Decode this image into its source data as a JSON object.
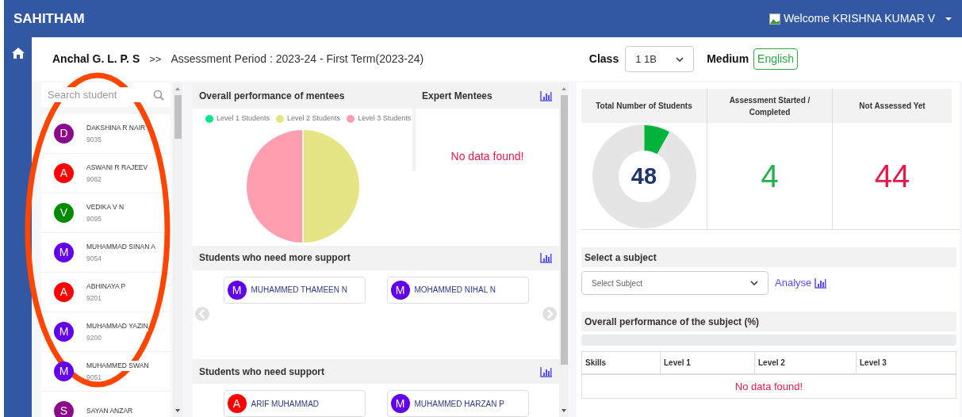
{
  "header": {
    "brand": "SAHITHAM",
    "welcome": "Welcome KRISHNA KUMAR V"
  },
  "breadcrumb": {
    "school": "Anchal G. L. P. S",
    "separator": ">>",
    "period": "Assessment Period : 2023-24 - First Term(2023-24)"
  },
  "filters": {
    "class_label": "Class",
    "class_value": "1 1B",
    "medium_label": "Medium",
    "medium_value": "English"
  },
  "search": {
    "placeholder": "Search student"
  },
  "students": [
    {
      "initial": "D",
      "name": "DAKSHINA R NAIR",
      "id": "9035",
      "color": "#8b0a8b"
    },
    {
      "initial": "A",
      "name": "ASWANI R RAJEEV",
      "id": "9082",
      "color": "#ff0000"
    },
    {
      "initial": "V",
      "name": "VEDIKA V N",
      "id": "9095",
      "color": "#008a00"
    },
    {
      "initial": "M",
      "name": "MUHAMMAD SINAN A",
      "id": "9054",
      "color": "#6200ea"
    },
    {
      "initial": "A",
      "name": "ABHINAYA P",
      "id": "9201",
      "color": "#ff0000"
    },
    {
      "initial": "M",
      "name": "MUHAMMAD YAZIN",
      "id": "9200",
      "color": "#6200ea"
    },
    {
      "initial": "M",
      "name": "MUHAMMED  SWAN",
      "id": "9051",
      "color": "#6200ea"
    },
    {
      "initial": "S",
      "name": "SAYAN ANZAR",
      "color": "#8b0a8b"
    }
  ],
  "performance": {
    "title": "Overall performance of mentees",
    "legend": [
      {
        "label": "Level 1 Students",
        "color": "#00e68a"
      },
      {
        "label": "Level 2 Students",
        "color": "#e6e585"
      },
      {
        "label": "Level 3 Students",
        "color": "#fe9eae"
      }
    ]
  },
  "expert": {
    "title": "Expert Mentees",
    "empty": "No data found!"
  },
  "more_support": {
    "title": "Students who need more support",
    "students": [
      {
        "initial": "M",
        "name": "MUHAMMED THAMEEN N",
        "color": "#6200ea"
      },
      {
        "initial": "M",
        "name": "MOHAMMED NIHAL N",
        "color": "#6200ea"
      }
    ]
  },
  "support": {
    "title": "Students who need support",
    "students": [
      {
        "initial": "A",
        "name": "ARIF MUHAMMAD",
        "color": "#ff0000"
      },
      {
        "initial": "M",
        "name": "MUHAMMED HARZAN P",
        "color": "#6200ea"
      }
    ]
  },
  "stats": {
    "columns": [
      "Total Number of Students",
      "Assessment Started / Completed",
      "Not Assessed Yet"
    ],
    "total": "48",
    "started": "4",
    "not_assessed": "44"
  },
  "subject": {
    "title": "Select a subject",
    "placeholder": "Select Subject",
    "analyse": "Analyse"
  },
  "subject_performance": {
    "title": "Overall performance of the subject (%)",
    "columns": [
      "Skills",
      "Level 1",
      "Level 2",
      "Level 3"
    ],
    "empty": "No data found!"
  }
}
